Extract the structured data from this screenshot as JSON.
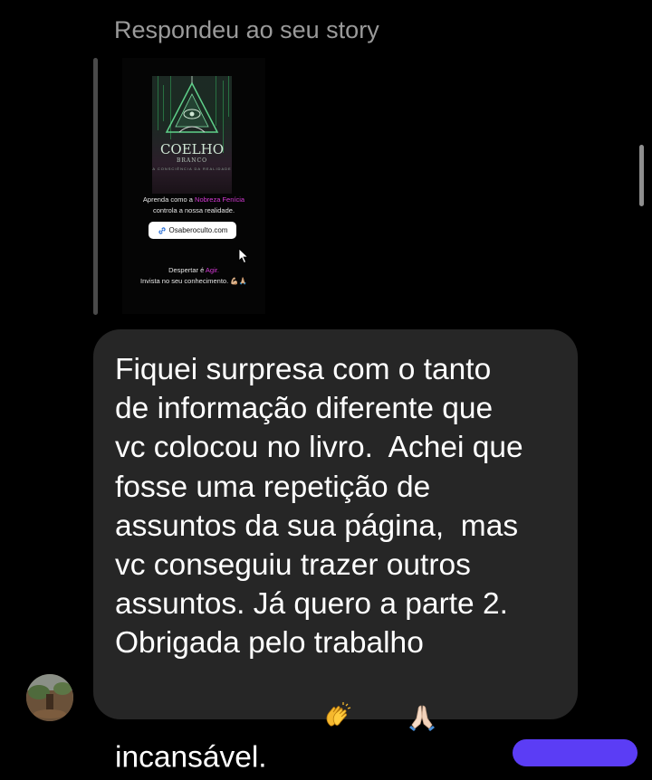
{
  "conversation": {
    "reply_header": "Respondeu ao seu story",
    "story": {
      "book_title": "COELHO",
      "book_subtitle": "BRANCO",
      "book_tagline": "A CONSCIÊNCIA DA REALIDADE",
      "caption_line1_pre": "Aprenda como a ",
      "caption_line1_highlight": "Nobreza Fenícia",
      "caption_line2": "controla a nossa realidade.",
      "link_label": "Osaberoculto.com",
      "footer_line1_pre": "Despertar é ",
      "footer_line1_highlight": "Agir.",
      "footer_line2": "Invista no seu conhecimento. 💪🏼🙏🏼"
    },
    "message": {
      "text": "Fiquei surpresa com o tanto\nde informação diferente que\nvc colocou no livro.  Achei que\nfosse uma repetição de\nassuntos da sua página,  mas\nvc conseguiu trazer outros\nassuntos. Já quero a parte 2.\nObrigada pelo trabalho\nincansável.",
      "emojis": [
        "clapping-hands",
        "folded-hands"
      ]
    }
  },
  "colors": {
    "background": "#000000",
    "bubble": "#262626",
    "header_text": "#9a9a9a",
    "highlight_pink": "#d63ad6",
    "outgoing_bubble": "#5b3df5"
  }
}
